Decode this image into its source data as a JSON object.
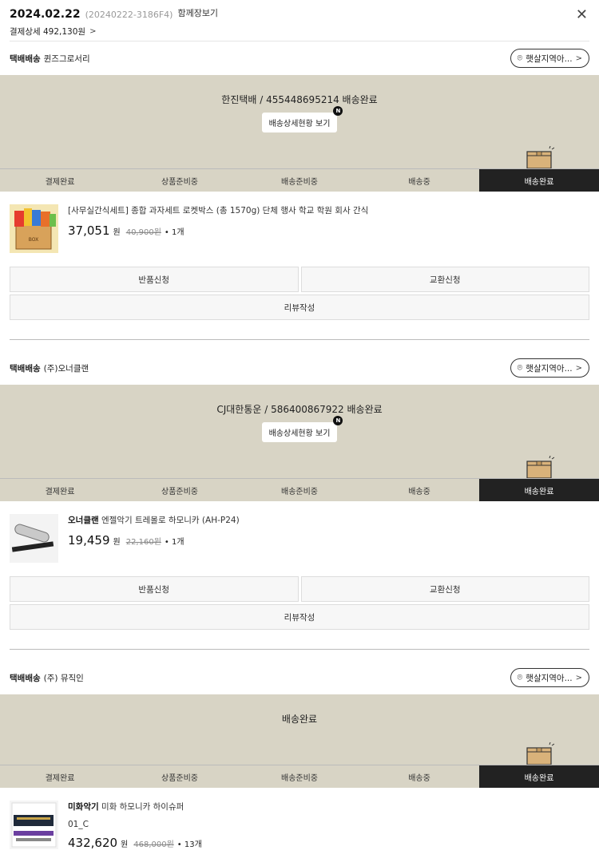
{
  "header": {
    "date": "2024.02.22",
    "order_no": "(20240222-3186F4)",
    "combined_label": "함께장보기",
    "payment_label": "결제상세 492,130원"
  },
  "groups": [
    {
      "delivery_type": "택배배송",
      "seller": "퀸즈그로서리",
      "location_label": "햇살지역아...",
      "tracking": "한진택배 / 455448695214 배송완료",
      "detail_label": "배송상세현황 보기",
      "badge": "N",
      "steps": [
        "결제완료",
        "상품준비중",
        "배송준비중",
        "배송중",
        "배송완료"
      ],
      "product": {
        "name": "[사무실간식세트] 종합 과자세트 로켓박스 (총 1570g) 단체 행사 학교 학원 회사 간식",
        "price": "37,051",
        "won": "원",
        "orig_price": "40,900원",
        "qty": "• 1개"
      },
      "actions": {
        "return": "반품신청",
        "exchange": "교환신청",
        "review": "리뷰작성"
      }
    },
    {
      "delivery_type": "택배배송",
      "seller": "(주)오너클랜",
      "location_label": "햇살지역아...",
      "tracking": "CJ대한통운 / 586400867922 배송완료",
      "detail_label": "배송상세현황 보기",
      "badge": "N",
      "steps": [
        "결제완료",
        "상품준비중",
        "배송준비중",
        "배송중",
        "배송완료"
      ],
      "product": {
        "brand": "오너클랜",
        "name": "엔젤악기 트레몰로 하모니카 (AH-P24)",
        "price": "19,459",
        "won": "원",
        "orig_price": "22,160원",
        "qty": "• 1개"
      },
      "actions": {
        "return": "반품신청",
        "exchange": "교환신청",
        "review": "리뷰작성"
      }
    },
    {
      "delivery_type": "택배배송",
      "seller": "(주) 뮤직인",
      "location_label": "햇살지역아...",
      "tracking": "배송완료",
      "steps": [
        "결제완료",
        "상품준비중",
        "배송준비중",
        "배송중",
        "배송완료"
      ],
      "product": {
        "brand": "미화악기",
        "name": "미화 하모니카 하이슈퍼",
        "option": "01_C",
        "price": "432,620",
        "won": "원",
        "orig_price": "468,000원",
        "qty": "• 13개"
      }
    }
  ],
  "icons": {
    "close": "close-icon",
    "chevron": "chevron-right-icon",
    "pin": "location-pin-icon",
    "box": "delivery-box-icon"
  },
  "colors": {
    "panel": "#d8d4c5",
    "active_step": "#222222"
  }
}
